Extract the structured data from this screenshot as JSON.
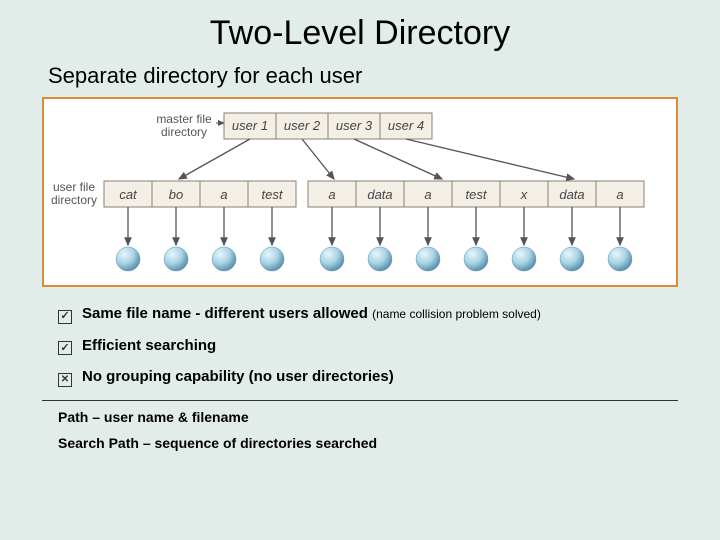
{
  "title": "Two-Level Directory",
  "subtitle": "Separate directory for each user",
  "diagram": {
    "mfd_label_line1": "master file",
    "mfd_label_line2": "directory",
    "users": [
      "user 1",
      "user 2",
      "user 3",
      "user 4"
    ],
    "ufd_label_line1": "user file",
    "ufd_label_line2": "directory",
    "files": [
      "cat",
      "bo",
      "a",
      "test",
      "a",
      "data",
      "a",
      "test",
      "x",
      "data",
      "a"
    ]
  },
  "bullets": [
    {
      "icon": "check",
      "main": "Same  file name - different users allowed ",
      "note": "(name collision problem solved)"
    },
    {
      "icon": "check",
      "main": "Efficient searching",
      "note": ""
    },
    {
      "icon": "cross",
      "main": "No grouping capability (no user directories)",
      "note": ""
    }
  ],
  "footer": {
    "path": "Path – user name & filename",
    "search": "Search Path – sequence of directories searched"
  },
  "colors": {
    "box_border": "#d98a3a",
    "cell_fill": "#f4efe6",
    "cell_stroke": "#8a8070",
    "ball_top": "#d9eef7",
    "ball_bot": "#6ba8c4",
    "arrow": "#555"
  }
}
